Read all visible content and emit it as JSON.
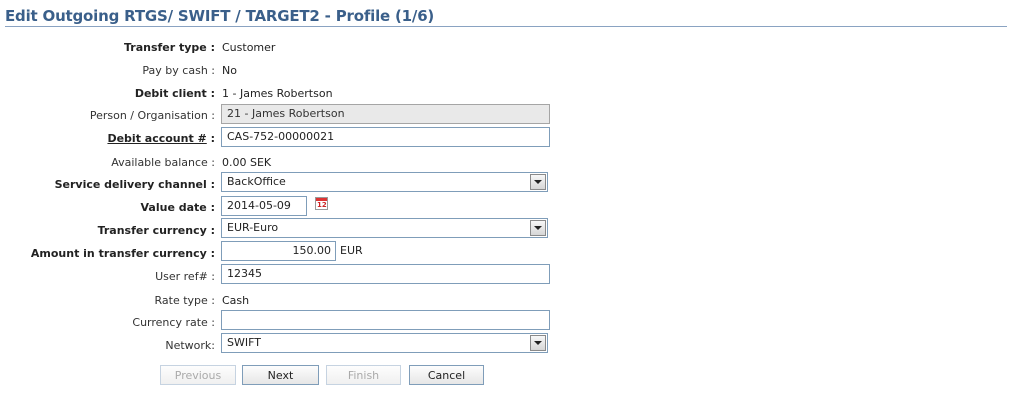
{
  "page": {
    "title": "Edit Outgoing RTGS/ SWIFT / TARGET2 - Profile (1/6)"
  },
  "form": {
    "transfer_type": {
      "label": "Transfer type :",
      "value": "Customer"
    },
    "pay_by_cash": {
      "label": "Pay by cash :",
      "value": "No"
    },
    "debit_client": {
      "label": "Debit client :",
      "value": "1 - James Robertson"
    },
    "person_org": {
      "label": "Person / Organisation :",
      "value": "21 - James Robertson"
    },
    "debit_account": {
      "label": "Debit account #",
      "label_suffix": " :",
      "value": "CAS-752-00000021"
    },
    "available_balance": {
      "label": "Available balance :",
      "value": "0.00",
      "unit": "SEK"
    },
    "service_channel": {
      "label": "Service delivery channel :",
      "value": "BackOffice"
    },
    "value_date": {
      "label": "Value date :",
      "value": "2014-05-09",
      "calendar_text": "12"
    },
    "transfer_currency": {
      "label": "Transfer currency :",
      "value": "EUR-Euro"
    },
    "amount": {
      "label": "Amount in transfer currency :",
      "value": "150.00",
      "unit": "EUR"
    },
    "user_ref": {
      "label": "User ref# :",
      "value": "12345"
    },
    "rate_type": {
      "label": "Rate type :",
      "value": "Cash"
    },
    "currency_rate": {
      "label": "Currency rate :",
      "value": ""
    },
    "network": {
      "label": "Network:",
      "value": "SWIFT"
    }
  },
  "buttons": {
    "previous": "Previous",
    "next": "Next",
    "finish": "Finish",
    "cancel": "Cancel"
  }
}
